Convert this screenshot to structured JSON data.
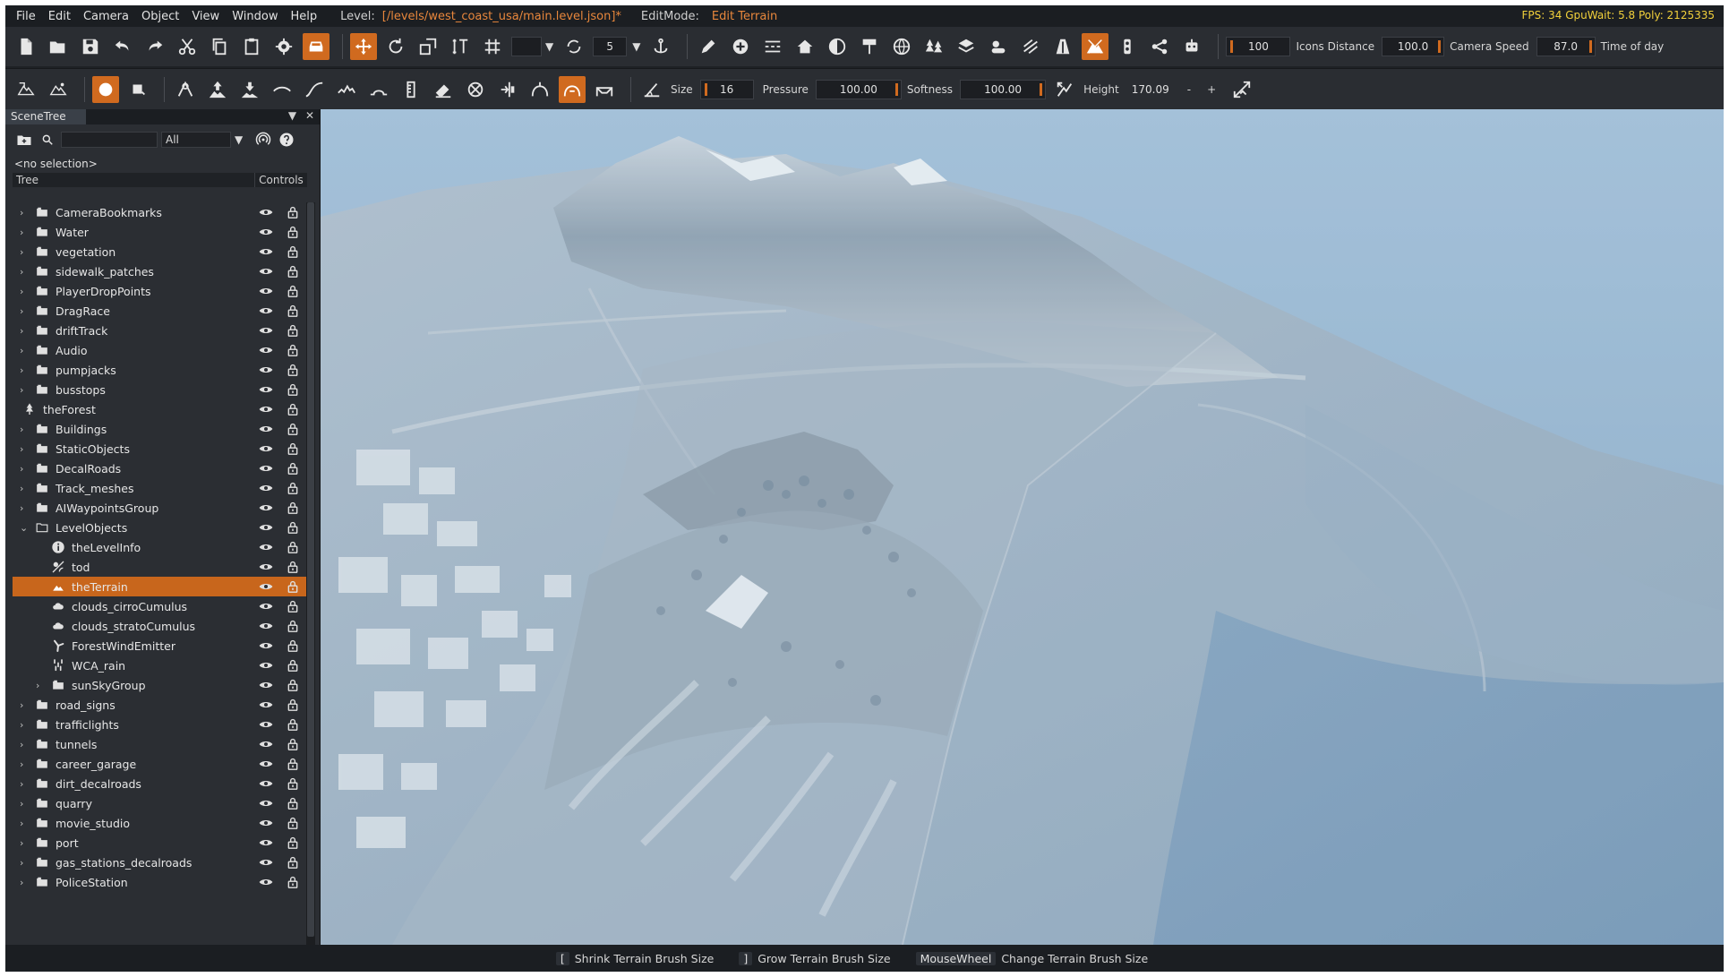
{
  "menubar": {
    "items": [
      "File",
      "Edit",
      "Camera",
      "Object",
      "View",
      "Window",
      "Help"
    ],
    "level_label": "Level:",
    "level_path": "[/levels/west_coast_usa/main.level.json]*",
    "editmode_label": "EditMode:",
    "editmode_value": "Edit Terrain",
    "stats": "FPS: 34  GpuWait: 5.8  Poly: 2125335"
  },
  "toolbar_top": {
    "snap_value": "5",
    "icons_distance_value": "100",
    "icons_distance_label": "Icons Distance",
    "camera_speed_value_a": "100.0",
    "camera_speed_label": "Camera Speed",
    "camera_speed_value_b": "87.0",
    "time_of_day_label": "Time of day"
  },
  "toolbar_terrain": {
    "size_label": "Size",
    "size_value": "16",
    "pressure_label": "Pressure",
    "pressure_value": "100.00",
    "softness_label": "Softness",
    "softness_value": "100.00",
    "height_label": "Height",
    "height_value": "170.09",
    "minus": "-",
    "plus": "+"
  },
  "scene_tree": {
    "tab_title": "SceneTree",
    "filter_value": "All",
    "no_selection": "<no selection>",
    "header_tree": "Tree",
    "header_controls": "Controls",
    "items": [
      {
        "name": "CameraBookmarks",
        "icon": "folder-icon",
        "expand": "collapsed",
        "indent": 0
      },
      {
        "name": "Water",
        "icon": "folder-icon",
        "expand": "collapsed",
        "indent": 0
      },
      {
        "name": "vegetation",
        "icon": "folder-icon",
        "expand": "collapsed",
        "indent": 0
      },
      {
        "name": "sidewalk_patches",
        "icon": "folder-icon",
        "expand": "collapsed",
        "indent": 0
      },
      {
        "name": "PlayerDropPoints",
        "icon": "folder-icon",
        "expand": "collapsed",
        "indent": 0
      },
      {
        "name": "DragRace",
        "icon": "folder-icon",
        "expand": "collapsed",
        "indent": 0
      },
      {
        "name": "driftTrack",
        "icon": "folder-icon",
        "expand": "collapsed",
        "indent": 0
      },
      {
        "name": "Audio",
        "icon": "folder-icon",
        "expand": "collapsed",
        "indent": 0
      },
      {
        "name": "pumpjacks",
        "icon": "folder-icon",
        "expand": "collapsed",
        "indent": 0
      },
      {
        "name": "busstops",
        "icon": "folder-icon",
        "expand": "collapsed",
        "indent": 0
      },
      {
        "name": "theForest",
        "icon": "forest-icon",
        "expand": "none",
        "indent": -1
      },
      {
        "name": "Buildings",
        "icon": "folder-icon",
        "expand": "collapsed",
        "indent": 0
      },
      {
        "name": "StaticObjects",
        "icon": "folder-icon",
        "expand": "collapsed",
        "indent": 0
      },
      {
        "name": "DecalRoads",
        "icon": "folder-icon",
        "expand": "collapsed",
        "indent": 0
      },
      {
        "name": "Track_meshes",
        "icon": "folder-icon",
        "expand": "collapsed",
        "indent": 0
      },
      {
        "name": "AIWaypointsGroup",
        "icon": "folder-icon",
        "expand": "collapsed",
        "indent": 0
      },
      {
        "name": "LevelObjects",
        "icon": "folder-open-icon",
        "expand": "expanded",
        "indent": 0
      },
      {
        "name": "theLevelInfo",
        "icon": "info-icon",
        "expand": "none",
        "indent": 1
      },
      {
        "name": "tod",
        "icon": "time-of-day-icon",
        "expand": "none",
        "indent": 1
      },
      {
        "name": "theTerrain",
        "icon": "terrain-icon",
        "expand": "none",
        "indent": 1,
        "selected": true
      },
      {
        "name": "clouds_cirroCumulus",
        "icon": "cloud-icon",
        "expand": "none",
        "indent": 1
      },
      {
        "name": "clouds_stratoCumulus",
        "icon": "cloud-icon",
        "expand": "none",
        "indent": 1
      },
      {
        "name": "ForestWindEmitter",
        "icon": "wind-icon",
        "expand": "none",
        "indent": 1
      },
      {
        "name": "WCA_rain",
        "icon": "rain-icon",
        "expand": "none",
        "indent": 1
      },
      {
        "name": "sunSkyGroup",
        "icon": "folder-icon",
        "expand": "collapsed",
        "indent": 1
      },
      {
        "name": "road_signs",
        "icon": "folder-icon",
        "expand": "collapsed",
        "indent": 0
      },
      {
        "name": "trafficlights",
        "icon": "folder-icon",
        "expand": "collapsed",
        "indent": 0
      },
      {
        "name": "tunnels",
        "icon": "folder-icon",
        "expand": "collapsed",
        "indent": 0
      },
      {
        "name": "career_garage",
        "icon": "folder-icon",
        "expand": "collapsed",
        "indent": 0
      },
      {
        "name": "dirt_decalroads",
        "icon": "folder-icon",
        "expand": "collapsed",
        "indent": 0
      },
      {
        "name": "quarry",
        "icon": "folder-icon",
        "expand": "collapsed",
        "indent": 0
      },
      {
        "name": "movie_studio",
        "icon": "folder-icon",
        "expand": "collapsed",
        "indent": 0
      },
      {
        "name": "port",
        "icon": "folder-icon",
        "expand": "collapsed",
        "indent": 0
      },
      {
        "name": "gas_stations_decalroads",
        "icon": "folder-icon",
        "expand": "collapsed",
        "indent": 0
      },
      {
        "name": "PoliceStation",
        "icon": "folder-icon",
        "expand": "collapsed",
        "indent": 0
      }
    ]
  },
  "statusbar": {
    "hints": [
      {
        "key": "[",
        "text": "Shrink Terrain Brush Size"
      },
      {
        "key": "]",
        "text": "Grow Terrain Brush Size"
      },
      {
        "key": "MouseWheel",
        "text": "Change Terrain Brush Size"
      }
    ]
  },
  "colors": {
    "accent": "#c8661c",
    "stats": "#f2d13b",
    "path": "#e8873c",
    "sky": "#8fb0cc"
  }
}
